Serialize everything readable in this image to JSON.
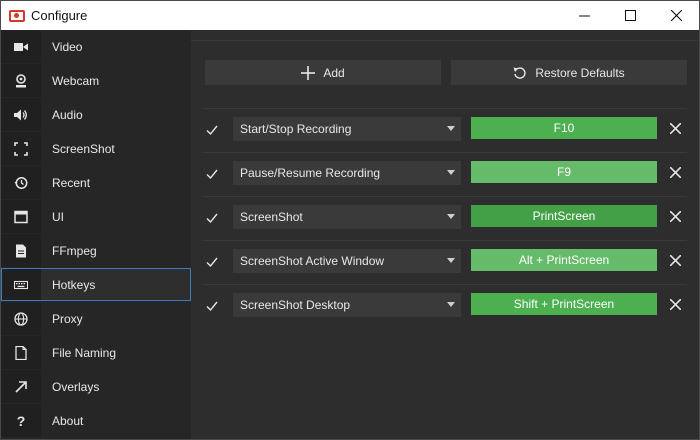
{
  "window": {
    "title": "Configure"
  },
  "sidebar": {
    "items": [
      {
        "label": "Video",
        "icon": "video-camera-icon"
      },
      {
        "label": "Webcam",
        "icon": "webcam-icon"
      },
      {
        "label": "Audio",
        "icon": "speaker-icon"
      },
      {
        "label": "ScreenShot",
        "icon": "screenshot-frame-icon"
      },
      {
        "label": "Recent",
        "icon": "history-icon"
      },
      {
        "label": "UI",
        "icon": "window-icon"
      },
      {
        "label": "FFmpeg",
        "icon": "file-icon"
      },
      {
        "label": "Hotkeys",
        "icon": "keyboard-icon",
        "active": true
      },
      {
        "label": "Proxy",
        "icon": "globe-icon"
      },
      {
        "label": "File Naming",
        "icon": "file-naming-icon"
      },
      {
        "label": "Overlays",
        "icon": "arrow-up-right-icon"
      },
      {
        "label": "About",
        "icon": "question-icon"
      }
    ]
  },
  "toolbar": {
    "add_label": "Add",
    "restore_label": "Restore Defaults"
  },
  "hotkeys": [
    {
      "action": "Start/Stop Recording",
      "key": "F10",
      "enabled": true,
      "color": "#4caf50"
    },
    {
      "action": "Pause/Resume Recording",
      "key": "F9",
      "enabled": true,
      "color": "#66bb6a"
    },
    {
      "action": "ScreenShot",
      "key": "PrintScreen",
      "enabled": true,
      "color": "#43a047"
    },
    {
      "action": "ScreenShot Active Window",
      "key": "Alt + PrintScreen",
      "enabled": true,
      "color": "#66bb6a"
    },
    {
      "action": "ScreenShot Desktop",
      "key": "Shift + PrintScreen",
      "enabled": true,
      "color": "#4caf50"
    }
  ]
}
